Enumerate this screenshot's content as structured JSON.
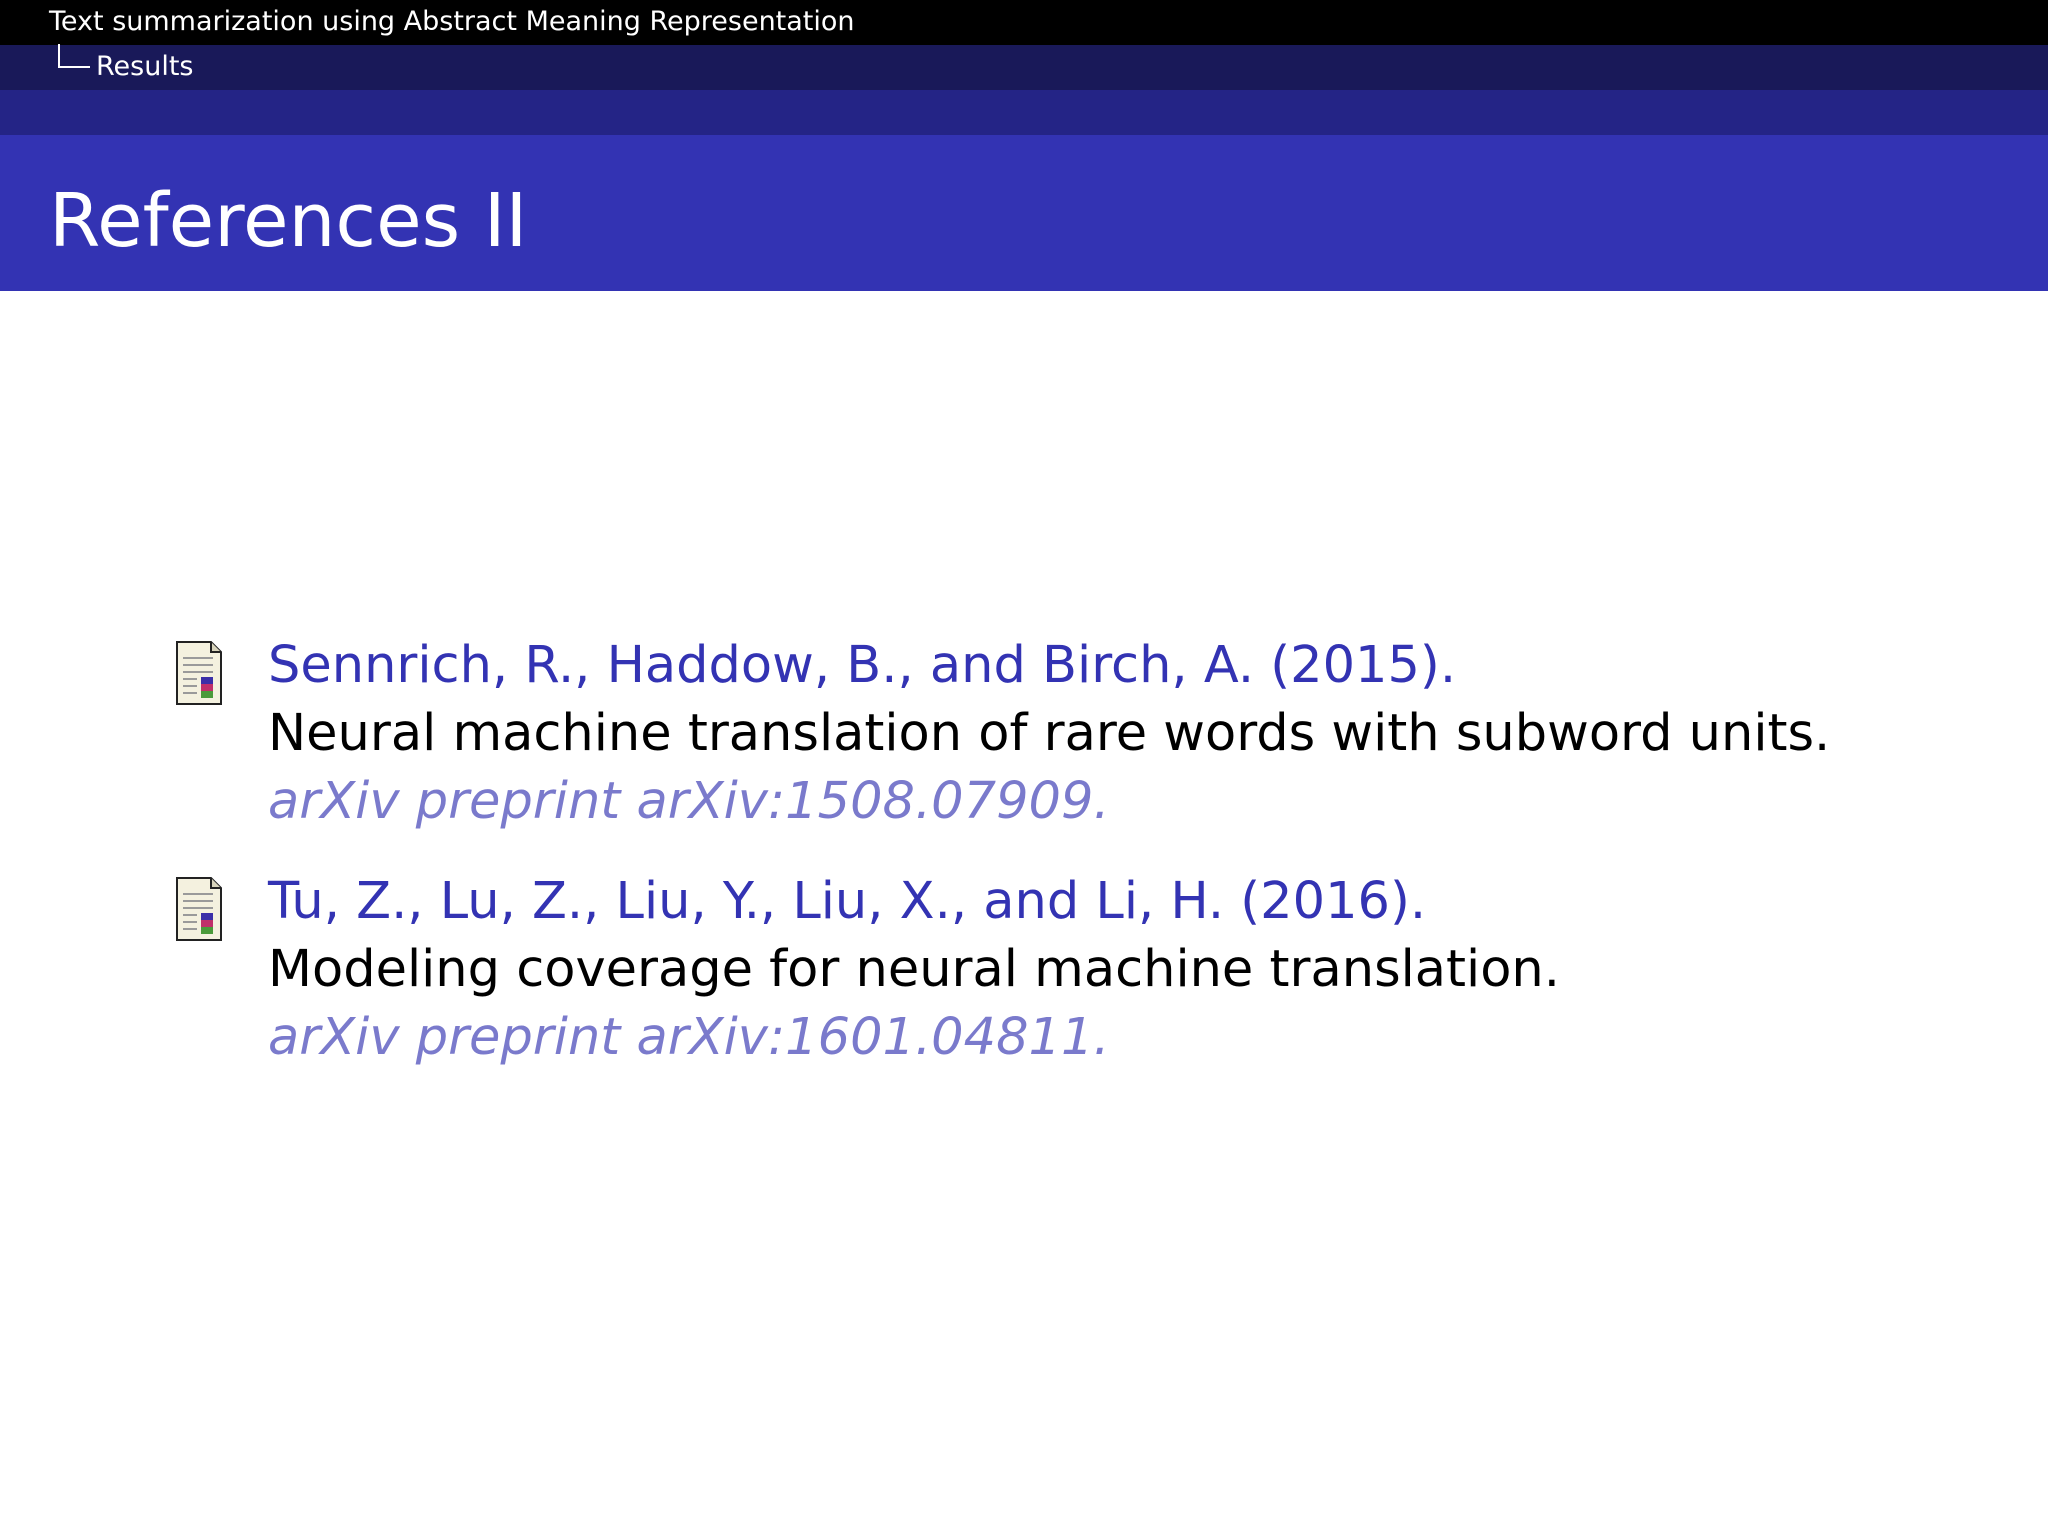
{
  "header": {
    "document_title": "Text summarization using Abstract Meaning Representation",
    "section": "Results"
  },
  "frame": {
    "title": "References II"
  },
  "references": [
    {
      "icon": "article-icon",
      "authors": "Sennrich, R., Haddow, B., and Birch, A. (2015).",
      "title": "Neural machine translation of rare words with subword units.",
      "venue": "arXiv preprint arXiv:1508.07909."
    },
    {
      "icon": "article-icon",
      "authors": "Tu, Z., Lu, Z., Liu, Y., Liu, X., and Li, H. (2016).",
      "title": "Modeling coverage for neural machine translation.",
      "venue": "arXiv preprint arXiv:1601.04811."
    }
  ],
  "colors": {
    "header_black": "#000000",
    "header_dark_navy": "#191959",
    "header_navy": "#242486",
    "title_bar_blue": "#3333b3",
    "author_text": "#3333b3",
    "venue_text": "#7a7acc"
  }
}
